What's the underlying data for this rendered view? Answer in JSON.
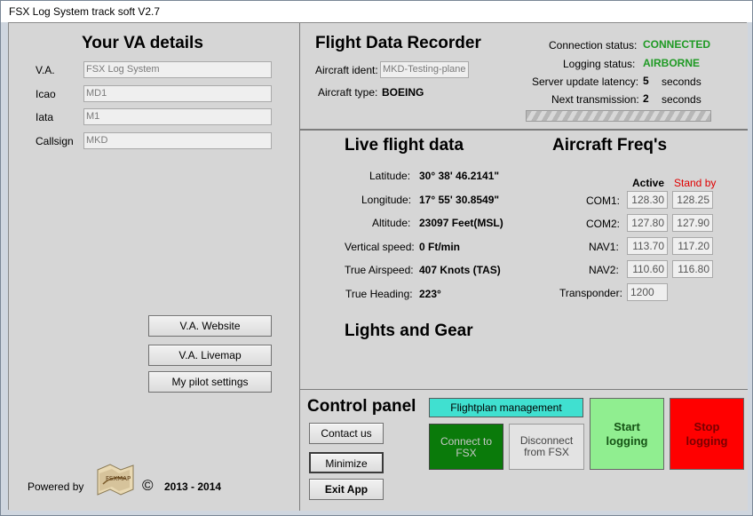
{
  "window": {
    "title": "FSX Log System track soft V2.7"
  },
  "va": {
    "heading": "Your VA details",
    "fields": [
      {
        "label": "V.A.",
        "value": "FSX Log System"
      },
      {
        "label": "Icao",
        "value": "MD1"
      },
      {
        "label": "Iata",
        "value": "M1"
      },
      {
        "label": "Callsign",
        "value": "MKD"
      }
    ],
    "buttons": {
      "website": "V.A. Website",
      "livemap": "V.A. Livemap",
      "settings": "My pilot settings"
    },
    "footer": {
      "powered_by": "Powered by",
      "copyright_symbol": "©",
      "years": "2013 - 2014",
      "logo_text": "FSXMAP"
    }
  },
  "recorder": {
    "heading": "Flight Data Recorder",
    "ident_label": "Aircraft ident:",
    "ident_value": "MKD-Testing-plane",
    "type_label": "Aircraft type:",
    "type_value": "BOEING",
    "status": [
      {
        "label": "Connection status:",
        "value": "CONNECTED",
        "unit": ""
      },
      {
        "label": "Logging status:",
        "value": "AIRBORNE",
        "unit": ""
      },
      {
        "label": "Server update latency:",
        "value": "5",
        "unit": "seconds"
      },
      {
        "label": "Next transmission:",
        "value": "2",
        "unit": "seconds"
      }
    ],
    "colors": {
      "status_ok": "#1f9a24"
    }
  },
  "live": {
    "heading": "Live flight data",
    "rows": [
      {
        "label": "Latitude:",
        "value": "30° 38' 46.2141\""
      },
      {
        "label": "Longitude:",
        "value": "17° 55' 30.8549\""
      },
      {
        "label": "Altitude:",
        "value": "23097 Feet(MSL)"
      },
      {
        "label": "Vertical speed:",
        "value": "0 Ft/min"
      },
      {
        "label": "True Airspeed:",
        "value": "407 Knots (TAS)"
      },
      {
        "label": "True Heading:",
        "value": "223°"
      }
    ],
    "lights_heading": "Lights and Gear"
  },
  "freqs": {
    "heading": "Aircraft Freq's",
    "active_label": "Active",
    "standby_label": "Stand by",
    "rows": [
      {
        "label": "COM1:",
        "active": "128.30",
        "standby": "128.25"
      },
      {
        "label": "COM2:",
        "active": "127.80",
        "standby": "127.90"
      },
      {
        "label": "NAV1:",
        "active": "113.70",
        "standby": "117.20"
      },
      {
        "label": "NAV2:",
        "active": "110.60",
        "standby": "116.80"
      }
    ],
    "transponder_label": "Transponder:",
    "transponder_value": "1200"
  },
  "control": {
    "heading": "Control panel",
    "contact": "Contact us",
    "minimize": "Minimize",
    "exit": "Exit App",
    "flightplan": "Flightplan management",
    "connect": "Connect to FSX",
    "disconnect": "Disconnect from FSX",
    "start": "Start logging",
    "stop": "Stop logging",
    "colors": {
      "flightplan": "#40e0d0",
      "connect": "#0a7a0a",
      "start": "#90ee90",
      "stop": "#ff0000"
    }
  }
}
